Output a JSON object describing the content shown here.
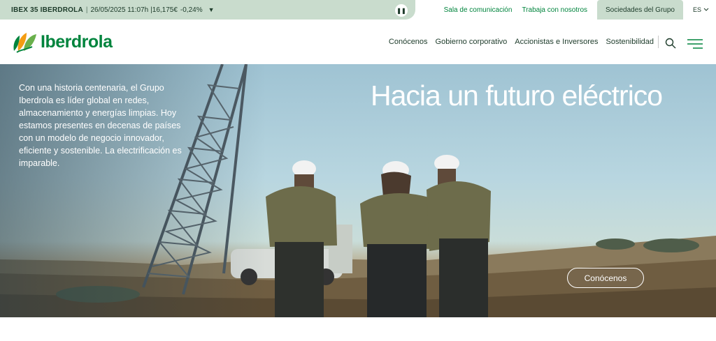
{
  "ticker": {
    "name": "IBEX 35 IBERDROLA",
    "separator": "|",
    "date": "26/05/2025 11:07h",
    "price": "|16,175€",
    "change": "-0,24%",
    "arrow": "▼",
    "pause_icon": "pause-icon"
  },
  "top_links": {
    "press": "Sala de comunicación",
    "careers": "Trabaja con nosotros",
    "group": "Sociedades del Grupo",
    "language": "ES"
  },
  "header": {
    "logo_text": "Iberdrola",
    "nav": [
      "Conócenos",
      "Gobierno corporativo",
      "Accionistas e Inversores",
      "Sostenibilidad"
    ],
    "search_icon": "search-icon",
    "menu_icon": "menu-icon"
  },
  "hero": {
    "intro": "Con una historia centenaria, el Grupo Iberdrola es líder global en redes, almacenamiento y energías limpias. Hoy estamos presentes en decenas de países con un modelo de negocio innovador, eficiente y sostenible. La electrificación es imparable.",
    "title": "Hacia un futuro eléctrico",
    "cta": "Conócenos"
  },
  "colors": {
    "brand_green": "#00843d",
    "ticker_bg": "#c9dccd",
    "text_dark": "#1d3b2a"
  }
}
